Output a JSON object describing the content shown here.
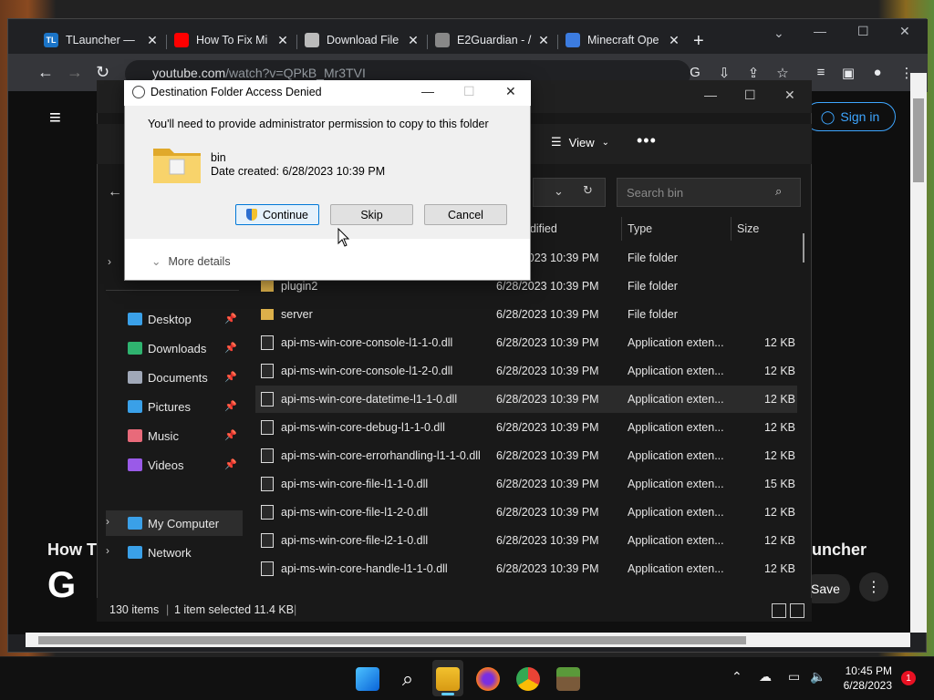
{
  "browser": {
    "tabs": [
      {
        "title": "TLauncher — ",
        "favicon": "TL",
        "color": "#1b74c7"
      },
      {
        "title": "How To Fix Mi",
        "favicon": "yt",
        "color": "#ff0000"
      },
      {
        "title": "Download File",
        "favicon": "search",
        "color": "#bbbbbb"
      },
      {
        "title": "E2Guardian - /",
        "favicon": "globe",
        "color": "#888888"
      },
      {
        "title": "Minecraft Ope",
        "favicon": "bookmark",
        "color": "#3c7ce0"
      }
    ],
    "tab_close": "✕",
    "new_tab": "+",
    "url_host": "youtube.com",
    "url_path": "/watch?v=QPkB_Mr3TVI"
  },
  "youtube": {
    "sign_in": "Sign in",
    "title_left": "How T",
    "title_right": "uncher",
    "save": "Save",
    "more": "⋮",
    "channel_letter": "G"
  },
  "explorer": {
    "view_label": "View",
    "search_placeholder": "Search bin",
    "columns": {
      "modified": "odified",
      "type": "Type",
      "size": "Size"
    },
    "nav": [
      {
        "label": "Desktop",
        "color": "#3aa0e8",
        "pinned": true
      },
      {
        "label": "Downloads",
        "color": "#2fb36f",
        "pinned": true
      },
      {
        "label": "Documents",
        "color": "#a0a8b8",
        "pinned": true
      },
      {
        "label": "Pictures",
        "color": "#3aa0e8",
        "pinned": true
      },
      {
        "label": "Music",
        "color": "#e86a7a",
        "pinned": true
      },
      {
        "label": "Videos",
        "color": "#9a5ae8",
        "pinned": true
      },
      {
        "label": "My Computer",
        "color": "#3aa0e8",
        "pinned": false
      },
      {
        "label": "Network",
        "color": "#3aa0e8",
        "pinned": false
      }
    ],
    "rows": [
      {
        "name": "",
        "date": "6/28/2023 10:39 PM",
        "type": "File folder",
        "size": "",
        "kind": "folder"
      },
      {
        "name": "plugin2",
        "date": "6/28/2023 10:39 PM",
        "type": "File folder",
        "size": "",
        "kind": "folder"
      },
      {
        "name": "server",
        "date": "6/28/2023 10:39 PM",
        "type": "File folder",
        "size": "",
        "kind": "folder"
      },
      {
        "name": "api-ms-win-core-console-l1-1-0.dll",
        "date": "6/28/2023 10:39 PM",
        "type": "Application exten...",
        "size": "12 KB",
        "kind": "file"
      },
      {
        "name": "api-ms-win-core-console-l1-2-0.dll",
        "date": "6/28/2023 10:39 PM",
        "type": "Application exten...",
        "size": "12 KB",
        "kind": "file"
      },
      {
        "name": "api-ms-win-core-datetime-l1-1-0.dll",
        "date": "6/28/2023 10:39 PM",
        "type": "Application exten...",
        "size": "12 KB",
        "kind": "file"
      },
      {
        "name": "api-ms-win-core-debug-l1-1-0.dll",
        "date": "6/28/2023 10:39 PM",
        "type": "Application exten...",
        "size": "12 KB",
        "kind": "file"
      },
      {
        "name": "api-ms-win-core-errorhandling-l1-1-0.dll",
        "date": "6/28/2023 10:39 PM",
        "type": "Application exten...",
        "size": "12 KB",
        "kind": "file"
      },
      {
        "name": "api-ms-win-core-file-l1-1-0.dll",
        "date": "6/28/2023 10:39 PM",
        "type": "Application exten...",
        "size": "15 KB",
        "kind": "file"
      },
      {
        "name": "api-ms-win-core-file-l1-2-0.dll",
        "date": "6/28/2023 10:39 PM",
        "type": "Application exten...",
        "size": "12 KB",
        "kind": "file"
      },
      {
        "name": "api-ms-win-core-file-l2-1-0.dll",
        "date": "6/28/2023 10:39 PM",
        "type": "Application exten...",
        "size": "12 KB",
        "kind": "file"
      },
      {
        "name": "api-ms-win-core-handle-l1-1-0.dll",
        "date": "6/28/2023 10:39 PM",
        "type": "Application exten...",
        "size": "12 KB",
        "kind": "file"
      }
    ],
    "status": {
      "items": "130 items",
      "selected": "1 item selected  11.4 KB"
    }
  },
  "dialog": {
    "title": "Destination Folder Access Denied",
    "message": "You'll need to provide administrator permission to copy to this folder",
    "folder_name": "bin",
    "folder_date": "Date created: 6/28/2023 10:39 PM",
    "continue": "Continue",
    "skip": "Skip",
    "cancel": "Cancel",
    "more_details": "More details"
  },
  "taskbar": {
    "time": "10:45 PM",
    "date": "6/28/2023",
    "notifications": "1"
  }
}
